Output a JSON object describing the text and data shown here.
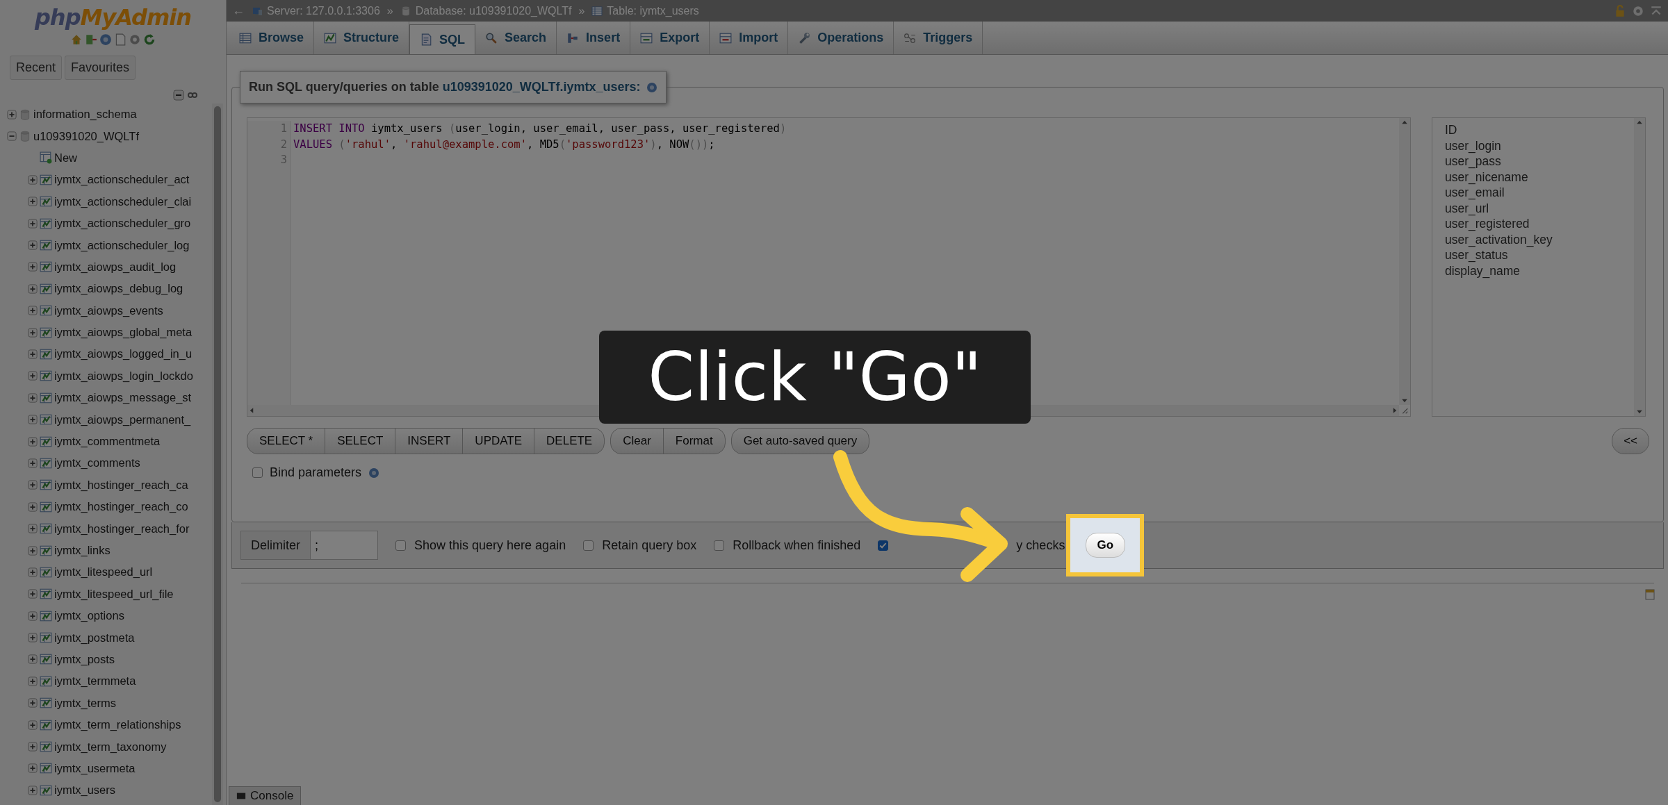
{
  "logo": {
    "part_1": "php",
    "part_2": "MyAdmin"
  },
  "sidebar": {
    "tabs": [
      {
        "label": "Recent",
        "selected": false
      },
      {
        "label": "Favourites",
        "selected": false
      }
    ],
    "tree": [
      {
        "label": "information_schema",
        "kind": "database",
        "expanded": false
      },
      {
        "label": "u109391020_WQLTf",
        "kind": "database",
        "expanded": true,
        "children": [
          {
            "label": "New",
            "kind": "new"
          },
          {
            "label": "iymtx_actionscheduler_act",
            "kind": "table",
            "expanded": false
          },
          {
            "label": "iymtx_actionscheduler_clai",
            "kind": "table",
            "expanded": false
          },
          {
            "label": "iymtx_actionscheduler_gro",
            "kind": "table",
            "expanded": false
          },
          {
            "label": "iymtx_actionscheduler_log",
            "kind": "table",
            "expanded": false
          },
          {
            "label": "iymtx_aiowps_audit_log",
            "kind": "table",
            "expanded": false
          },
          {
            "label": "iymtx_aiowps_debug_log",
            "kind": "table",
            "expanded": false
          },
          {
            "label": "iymtx_aiowps_events",
            "kind": "table",
            "expanded": false
          },
          {
            "label": "iymtx_aiowps_global_meta",
            "kind": "table",
            "expanded": false
          },
          {
            "label": "iymtx_aiowps_logged_in_u",
            "kind": "table",
            "expanded": false
          },
          {
            "label": "iymtx_aiowps_login_lockdo",
            "kind": "table",
            "expanded": false
          },
          {
            "label": "iymtx_aiowps_message_st",
            "kind": "table",
            "expanded": false
          },
          {
            "label": "iymtx_aiowps_permanent_",
            "kind": "table",
            "expanded": false
          },
          {
            "label": "iymtx_commentmeta",
            "kind": "table",
            "expanded": false
          },
          {
            "label": "iymtx_comments",
            "kind": "table",
            "expanded": false
          },
          {
            "label": "iymtx_hostinger_reach_ca",
            "kind": "table",
            "expanded": false
          },
          {
            "label": "iymtx_hostinger_reach_co",
            "kind": "table",
            "expanded": false
          },
          {
            "label": "iymtx_hostinger_reach_for",
            "kind": "table",
            "expanded": false
          },
          {
            "label": "iymtx_links",
            "kind": "table",
            "expanded": false
          },
          {
            "label": "iymtx_litespeed_url",
            "kind": "table",
            "expanded": false
          },
          {
            "label": "iymtx_litespeed_url_file",
            "kind": "table",
            "expanded": false
          },
          {
            "label": "iymtx_options",
            "kind": "table",
            "expanded": false
          },
          {
            "label": "iymtx_postmeta",
            "kind": "table",
            "expanded": false
          },
          {
            "label": "iymtx_posts",
            "kind": "table",
            "expanded": false
          },
          {
            "label": "iymtx_termmeta",
            "kind": "table",
            "expanded": false
          },
          {
            "label": "iymtx_terms",
            "kind": "table",
            "expanded": false
          },
          {
            "label": "iymtx_term_relationships",
            "kind": "table",
            "expanded": false
          },
          {
            "label": "iymtx_term_taxonomy",
            "kind": "table",
            "expanded": false
          },
          {
            "label": "iymtx_usermeta",
            "kind": "table",
            "expanded": false
          },
          {
            "label": "iymtx_users",
            "kind": "table",
            "expanded": false
          }
        ]
      }
    ]
  },
  "topbar": {
    "back": "←",
    "breadcrumb": [
      {
        "kind": "server",
        "label": "Server: 127.0.0.1:3306"
      },
      {
        "kind": "separator",
        "label": "»"
      },
      {
        "kind": "database",
        "label": "Database: u109391020_WQLTf"
      },
      {
        "kind": "separator",
        "label": "»"
      },
      {
        "kind": "table",
        "label": "Table: iymtx_users"
      }
    ]
  },
  "tabs": [
    {
      "label": "Browse",
      "kind": "browse",
      "selected": false
    },
    {
      "label": "Structure",
      "kind": "structure",
      "selected": false
    },
    {
      "label": "SQL",
      "kind": "sql",
      "selected": true
    },
    {
      "label": "Search",
      "kind": "search",
      "selected": false
    },
    {
      "label": "Insert",
      "kind": "insert",
      "selected": false
    },
    {
      "label": "Export",
      "kind": "export",
      "selected": false
    },
    {
      "label": "Import",
      "kind": "import",
      "selected": false
    },
    {
      "label": "Operations",
      "kind": "operations",
      "selected": false
    },
    {
      "label": "Triggers",
      "kind": "triggers",
      "selected": false
    }
  ],
  "query_box": {
    "legend": "Run SQL query/queries on table ",
    "legend_link": "u109391020_WQLTf.iymtx_users:",
    "code_lines": [
      {
        "number": "1",
        "tokens": [
          {
            "kind": "keyword",
            "text": "INSERT INTO"
          },
          {
            "kind": "plain",
            "text": " iymtx_users "
          },
          {
            "kind": "punct",
            "text": "("
          },
          {
            "kind": "plain",
            "text": "user_login, user_email, user_pass, user_registered"
          },
          {
            "kind": "punct",
            "text": ")"
          }
        ]
      },
      {
        "number": "2",
        "tokens": [
          {
            "kind": "keyword",
            "text": "VALUES"
          },
          {
            "kind": "punct",
            "text": " ("
          },
          {
            "kind": "string",
            "text": "'rahul'"
          },
          {
            "kind": "plain",
            "text": ", "
          },
          {
            "kind": "string",
            "text": "'rahul@example.com'"
          },
          {
            "kind": "plain",
            "text": ", MD5"
          },
          {
            "kind": "punct",
            "text": "("
          },
          {
            "kind": "string",
            "text": "'password123'"
          },
          {
            "kind": "punct",
            "text": ")"
          },
          {
            "kind": "plain",
            "text": ", NOW"
          },
          {
            "kind": "punct",
            "text": "())"
          },
          {
            "kind": "plain",
            "text": ";"
          }
        ]
      },
      {
        "number": "3"
      }
    ],
    "columns": [
      "ID",
      "user_login",
      "user_pass",
      "user_nicename",
      "user_email",
      "user_url",
      "user_registered",
      "user_activation_key",
      "user_status",
      "display_name"
    ],
    "button_groups": [
      [
        "SELECT *",
        "SELECT",
        "INSERT",
        "UPDATE",
        "DELETE"
      ],
      [
        "Clear",
        "Format"
      ],
      [
        "Get auto-saved query"
      ]
    ],
    "insert_button": "<<",
    "bind_parameters": {
      "label": "Bind parameters",
      "checked": false
    }
  },
  "options": {
    "delimiter_label": "Delimiter",
    "delimiter_value": ";",
    "checkboxes": [
      {
        "label": "Show this query here again",
        "checked": false
      },
      {
        "label": "Retain query box",
        "checked": false
      },
      {
        "label": "Rollback when finished",
        "checked": false
      },
      {
        "label": "y checks",
        "checked": true
      }
    ],
    "go": "Go"
  },
  "console": "Console",
  "tutorial": {
    "callout": "Click \"Go\""
  }
}
